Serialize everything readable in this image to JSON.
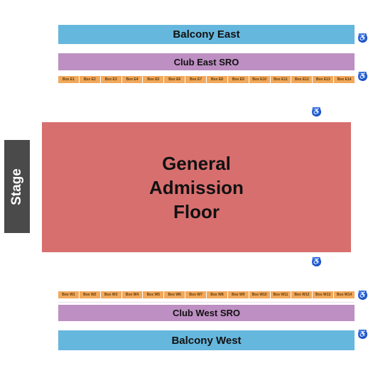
{
  "sections": {
    "balcony_east": "Balcony East",
    "club_east": "Club East SRO",
    "ga_floor": [
      "General",
      "Admission",
      "Floor"
    ],
    "club_west": "Club West SRO",
    "balcony_west": "Balcony West",
    "stage": "Stage"
  },
  "boxes_east": [
    "Box E1",
    "Box E2",
    "Box E3",
    "Box E4",
    "Box E5",
    "Box E6",
    "Box E7",
    "Box E8",
    "Box E9",
    "Box E10",
    "Box E11",
    "Box E12",
    "Box E13",
    "Box E14"
  ],
  "boxes_west": [
    "Box W1",
    "Box W2",
    "Box W3",
    "Box W4",
    "Box W5",
    "Box W6",
    "Box W7",
    "Box W8",
    "Box W9",
    "Box W10",
    "Box W11",
    "Box W12",
    "Box W13",
    "Box W14"
  ],
  "icons": {
    "accessible": "wheelchair-icon",
    "glyph": "♿"
  },
  "colors": {
    "balcony": "#66b7dd",
    "club": "#bd8fc2",
    "box": "#f2a85a",
    "ga_floor": "#d86f6f",
    "stage": "#4a4a4a",
    "accessible": "#1d4fd0"
  }
}
